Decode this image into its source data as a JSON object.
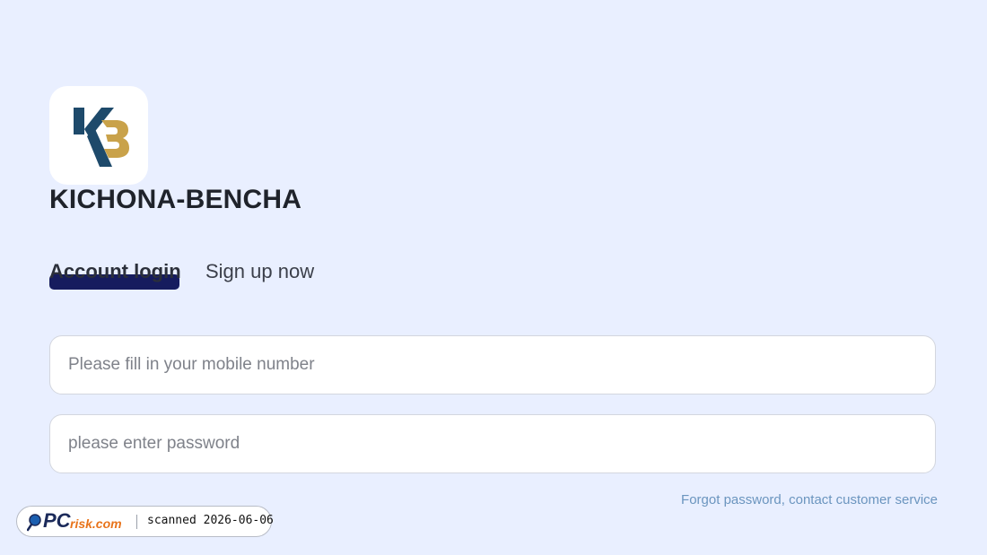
{
  "brand": {
    "name": "KICHONA-BENCHA",
    "logo_icon": "kb-monogram-icon",
    "colors": {
      "k_navy": "#1e4a6b",
      "b_gold": "#c9a24a"
    }
  },
  "tabs": [
    {
      "label": "Account login",
      "active": true
    },
    {
      "label": "Sign up now",
      "active": false
    }
  ],
  "form": {
    "phone_placeholder": "Please fill in your mobile number",
    "password_placeholder": "please enter password",
    "forgot_link": "Forgot password, contact customer service"
  },
  "watermark": {
    "brand_pc": "PC",
    "brand_risk": "risk.com",
    "scan_text": "scanned 2026-06-06",
    "icon": "magnifier-icon"
  },
  "theme": {
    "background": "#e9efff",
    "tab_indicator": "#161c5e",
    "link": "#6b95bf"
  }
}
